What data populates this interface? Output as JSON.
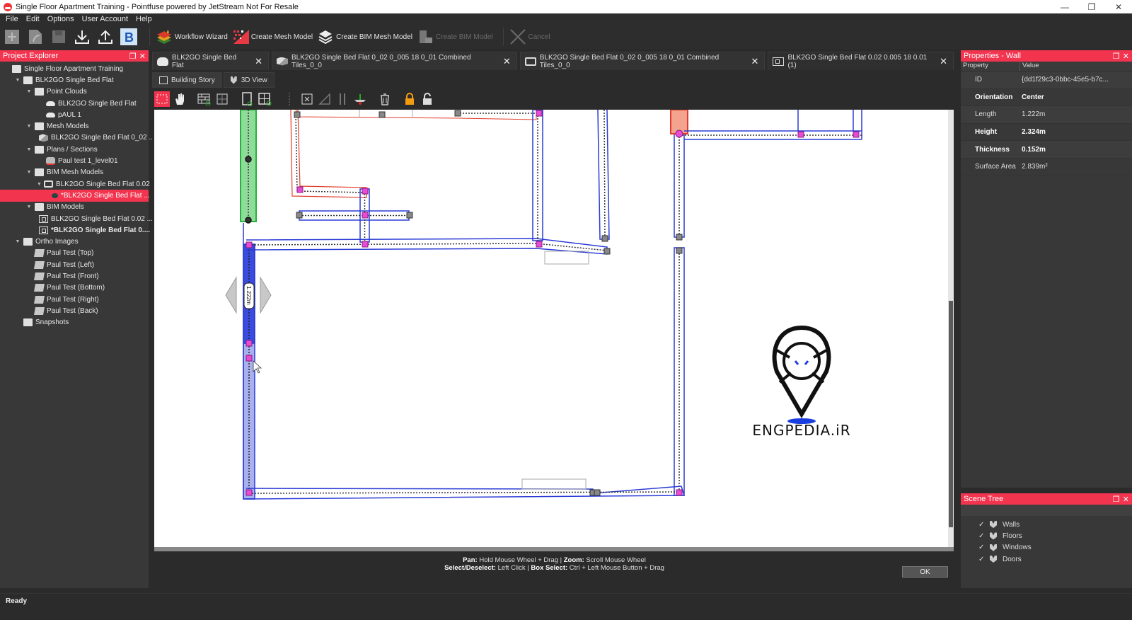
{
  "window": {
    "title": "Single Floor Apartment Training - Pointfuse powered by JetStream Not For Resale",
    "controls": [
      "minimize",
      "restore",
      "close"
    ]
  },
  "menu": [
    "File",
    "Edit",
    "Options",
    "User Account",
    "Help"
  ],
  "toolbar": {
    "buttons": [
      {
        "name": "new",
        "label": "",
        "enabled": false
      },
      {
        "name": "open",
        "label": "",
        "enabled": false
      },
      {
        "name": "save",
        "label": "",
        "enabled": false
      },
      {
        "name": "import",
        "label": "",
        "enabled": true
      },
      {
        "name": "export",
        "label": "",
        "enabled": true
      },
      {
        "name": "bim360",
        "label": "",
        "enabled": true
      }
    ],
    "workflow_wizard": "Workflow Wizard",
    "create_mesh_model": "Create Mesh Model",
    "create_bim_mesh_model": "Create BIM Mesh Model",
    "create_bim_model": "Create BIM Model",
    "cancel": "Cancel"
  },
  "project_explorer": {
    "title": "Project Explorer",
    "items": [
      {
        "label": "Single Floor Apartment Training",
        "icon": "folder",
        "level": 0,
        "expander": ""
      },
      {
        "label": "BLK2GO Single Bed Flat",
        "icon": "folder",
        "level": 1,
        "expander": "▼"
      },
      {
        "label": "Point Clouds",
        "icon": "folder",
        "level": 2,
        "expander": "▼"
      },
      {
        "label": "BLK2GO Single Bed Flat",
        "icon": "cloud",
        "level": 3,
        "expander": ""
      },
      {
        "label": "pAUL 1",
        "icon": "cloud",
        "level": 3,
        "expander": ""
      },
      {
        "label": "Mesh Models",
        "icon": "folder",
        "level": 2,
        "expander": "▼"
      },
      {
        "label": "BLK2GO Single Bed Flat 0_02 ...",
        "icon": "mesh",
        "level": 3,
        "expander": ""
      },
      {
        "label": "Plans / Sections",
        "icon": "folder",
        "level": 2,
        "expander": "▼"
      },
      {
        "label": "Paul test 1_level01",
        "icon": "plan",
        "level": 3,
        "expander": ""
      },
      {
        "label": "BIM Mesh Models",
        "icon": "folder",
        "level": 2,
        "expander": "▼"
      },
      {
        "label": "BLK2GO Single Bed Flat 0.02 ...",
        "icon": "layers",
        "level": 3,
        "expander": "▼"
      },
      {
        "label": "*BLK2GO Single Bed Flat ...",
        "icon": "eye",
        "level": 4,
        "expander": "",
        "selected": true
      },
      {
        "label": "BIM Models",
        "icon": "folder",
        "level": 2,
        "expander": "▼"
      },
      {
        "label": "BLK2GO Single Bed Flat 0.02 ...",
        "icon": "bim",
        "level": 3,
        "expander": ""
      },
      {
        "label": "*BLK2GO Single Bed Flat 0....",
        "icon": "bim",
        "level": 3,
        "expander": "",
        "bold": true
      },
      {
        "label": "Ortho Images",
        "icon": "folder",
        "level": 1,
        "expander": "▼"
      },
      {
        "label": "Paul Test (Top)",
        "icon": "ortho",
        "level": 2,
        "expander": ""
      },
      {
        "label": "Paul Test (Left)",
        "icon": "ortho",
        "level": 2,
        "expander": ""
      },
      {
        "label": "Paul Test (Front)",
        "icon": "ortho",
        "level": 2,
        "expander": ""
      },
      {
        "label": "Paul Test (Bottom)",
        "icon": "ortho",
        "level": 2,
        "expander": ""
      },
      {
        "label": "Paul Test (Right)",
        "icon": "ortho",
        "level": 2,
        "expander": ""
      },
      {
        "label": "Paul Test (Back)",
        "icon": "ortho",
        "level": 2,
        "expander": ""
      },
      {
        "label": "Snapshots",
        "icon": "folder",
        "level": 1,
        "expander": ""
      }
    ]
  },
  "doc_tabs": [
    {
      "label": "BLK2GO Single Bed Flat",
      "icon": "cloud",
      "active": false
    },
    {
      "label": "BLK2GO Single Bed Flat 0_02 0_005 18 0_01 Combined Tiles_0_0",
      "icon": "mesh",
      "active": false
    },
    {
      "label": "BLK2GO Single Bed Flat 0_02 0_005 18 0_01 Combined Tiles_0_0",
      "icon": "layers",
      "active": false
    },
    {
      "label": "BLK2GO Single Bed Flat 0.02 0.005 18 0.01 (1)",
      "icon": "bim",
      "active": true
    }
  ],
  "view_tabs": [
    {
      "label": "Building Story",
      "active": true
    },
    {
      "label": "3D View",
      "active": false
    }
  ],
  "edit_tools": [
    "box-select",
    "pan-hand",
    "add-wall",
    "split-wall",
    "add-door",
    "add-window",
    "align",
    "delete-joint",
    "angle",
    "parallel",
    "floor-split",
    "delete",
    "lock",
    "unlock"
  ],
  "canvas": {
    "dimension_label": "1.222m",
    "watermark": "ENGPEDIA.iR",
    "colors": {
      "selected_wall": "#3a4be0",
      "wall_outline": "#2a3bd6",
      "highlight_green": "#27b33a",
      "highlight_red": "#e23b2b",
      "joint": "#e84bd4"
    }
  },
  "hint": {
    "line1": [
      {
        "b": "Pan:"
      },
      {
        "t": " Hold Mouse Wheel + Drag | "
      },
      {
        "b": "Zoom:"
      },
      {
        "t": " Scroll Mouse Wheel"
      }
    ],
    "line2": [
      {
        "b": "Select/Deselect:"
      },
      {
        "t": " Left Click | "
      },
      {
        "b": "Box Select:"
      },
      {
        "t": " Ctrl + Left Mouse Button + Drag"
      }
    ]
  },
  "ok_button": "OK",
  "properties": {
    "title": "Properties - Wall",
    "col_property": "Property",
    "col_value": "Value",
    "rows": [
      {
        "key": "ID",
        "value": "{dd1f29c3-0bbc-45e5-b7c...",
        "bold": false
      },
      {
        "key": "Orientation",
        "value": "Center",
        "bold": true
      },
      {
        "key": "Length",
        "value": "1.222m",
        "bold": false
      },
      {
        "key": "Height",
        "value": "2.324m",
        "bold": true
      },
      {
        "key": "Thickness",
        "value": "0.152m",
        "bold": true
      },
      {
        "key": "Surface Area",
        "value": "2.839m²",
        "bold": false
      }
    ]
  },
  "scene_tree": {
    "title": "Scene Tree",
    "items": [
      {
        "label": "Walls",
        "checked": true
      },
      {
        "label": "Floors",
        "checked": true
      },
      {
        "label": "Windows",
        "checked": true
      },
      {
        "label": "Doors",
        "checked": true
      }
    ]
  },
  "status": "Ready",
  "accent_color": "#f2344f"
}
